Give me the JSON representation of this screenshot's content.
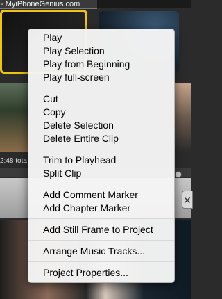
{
  "background": {
    "watermark": "- MyiPhoneGenius.com",
    "time_readout": "2:48 tota"
  },
  "close_tab_glyph": "✕",
  "menu": {
    "groups": [
      [
        "Play",
        "Play Selection",
        "Play from Beginning",
        "Play full-screen"
      ],
      [
        "Cut",
        "Copy",
        "Delete Selection",
        "Delete Entire Clip"
      ],
      [
        "Trim to Playhead",
        "Split Clip"
      ],
      [
        "Add Comment Marker",
        "Add Chapter Marker"
      ],
      [
        "Add Still Frame to Project"
      ],
      [
        "Arrange Music Tracks..."
      ],
      [
        "Project Properties..."
      ]
    ]
  },
  "colors": {
    "selection_border": "#f1c40f",
    "menu_background": "#f5f5f5"
  }
}
